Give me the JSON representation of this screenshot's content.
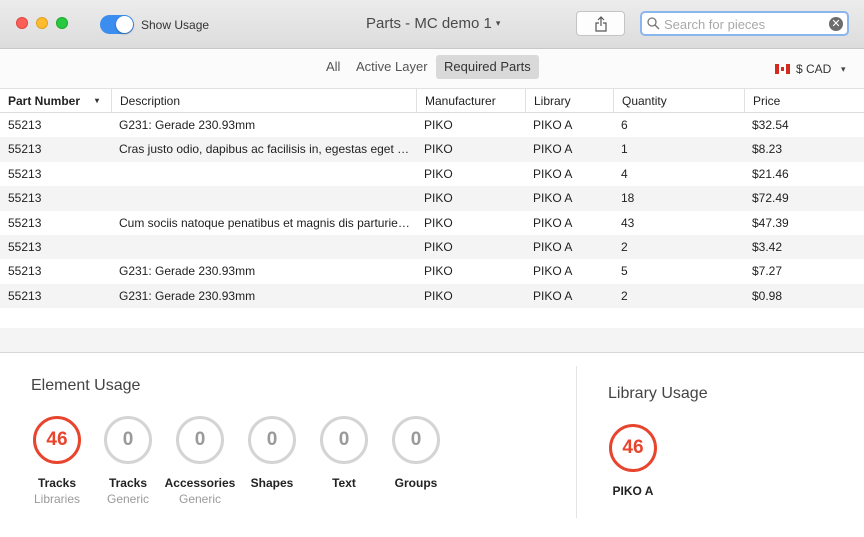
{
  "window": {
    "title": "Parts - MC demo 1",
    "title_caret": "▾",
    "show_usage_label": "Show Usage",
    "show_usage_on": true,
    "search_placeholder": "Search for pieces",
    "search_value": ""
  },
  "filters": {
    "items": [
      {
        "label": "All",
        "selected": false
      },
      {
        "label": "Active Layer",
        "selected": false
      },
      {
        "label": "Required Parts",
        "selected": true
      }
    ],
    "currency": "$ CAD",
    "currency_caret": "▾"
  },
  "table": {
    "columns": [
      "Part Number",
      "Description",
      "Manufacturer",
      "Library",
      "Quantity",
      "Price"
    ],
    "sort_caret": "▾",
    "rows": [
      [
        "55213",
        "G231: Gerade 230.93mm",
        "PIKO",
        "PIKO A",
        "6",
        "$32.54"
      ],
      [
        "55213",
        "Cras justo odio, dapibus ac facilisis in, egestas eget quam.",
        "PIKO",
        "PIKO A",
        "1",
        "$8.23"
      ],
      [
        "55213",
        "",
        "PIKO",
        "PIKO A",
        "4",
        "$21.46"
      ],
      [
        "55213",
        "",
        "PIKO",
        "PIKO A",
        "18",
        "$72.49"
      ],
      [
        "55213",
        "Cum sociis natoque penatibus et magnis dis parturient montes.",
        "PIKO",
        "PIKO A",
        "43",
        "$47.39"
      ],
      [
        "55213",
        "",
        "PIKO",
        "PIKO A",
        "2",
        "$3.42"
      ],
      [
        "55213",
        "G231: Gerade 230.93mm",
        "PIKO",
        "PIKO A",
        "5",
        "$7.27"
      ],
      [
        "55213",
        "G231: Gerade 230.93mm",
        "PIKO",
        "PIKO A",
        "2",
        "$0.98"
      ]
    ]
  },
  "element_usage": {
    "title": "Element Usage",
    "items": [
      {
        "count": "46",
        "label": "Tracks",
        "sub": "Libraries",
        "active": true
      },
      {
        "count": "0",
        "label": "Tracks",
        "sub": "Generic",
        "active": false
      },
      {
        "count": "0",
        "label": "Accessories",
        "sub": "Generic",
        "active": false
      },
      {
        "count": "0",
        "label": "Shapes",
        "sub": "",
        "active": false
      },
      {
        "count": "0",
        "label": "Text",
        "sub": "",
        "active": false
      },
      {
        "count": "0",
        "label": "Groups",
        "sub": "",
        "active": false
      }
    ]
  },
  "library_usage": {
    "title": "Library Usage",
    "items": [
      {
        "count": "46",
        "label": "PIKO A",
        "active": true
      }
    ]
  },
  "colors": {
    "accent_red": "#e8452f",
    "toggle_blue": "#3b8df0",
    "selected_segment": "#d9d9d9"
  }
}
